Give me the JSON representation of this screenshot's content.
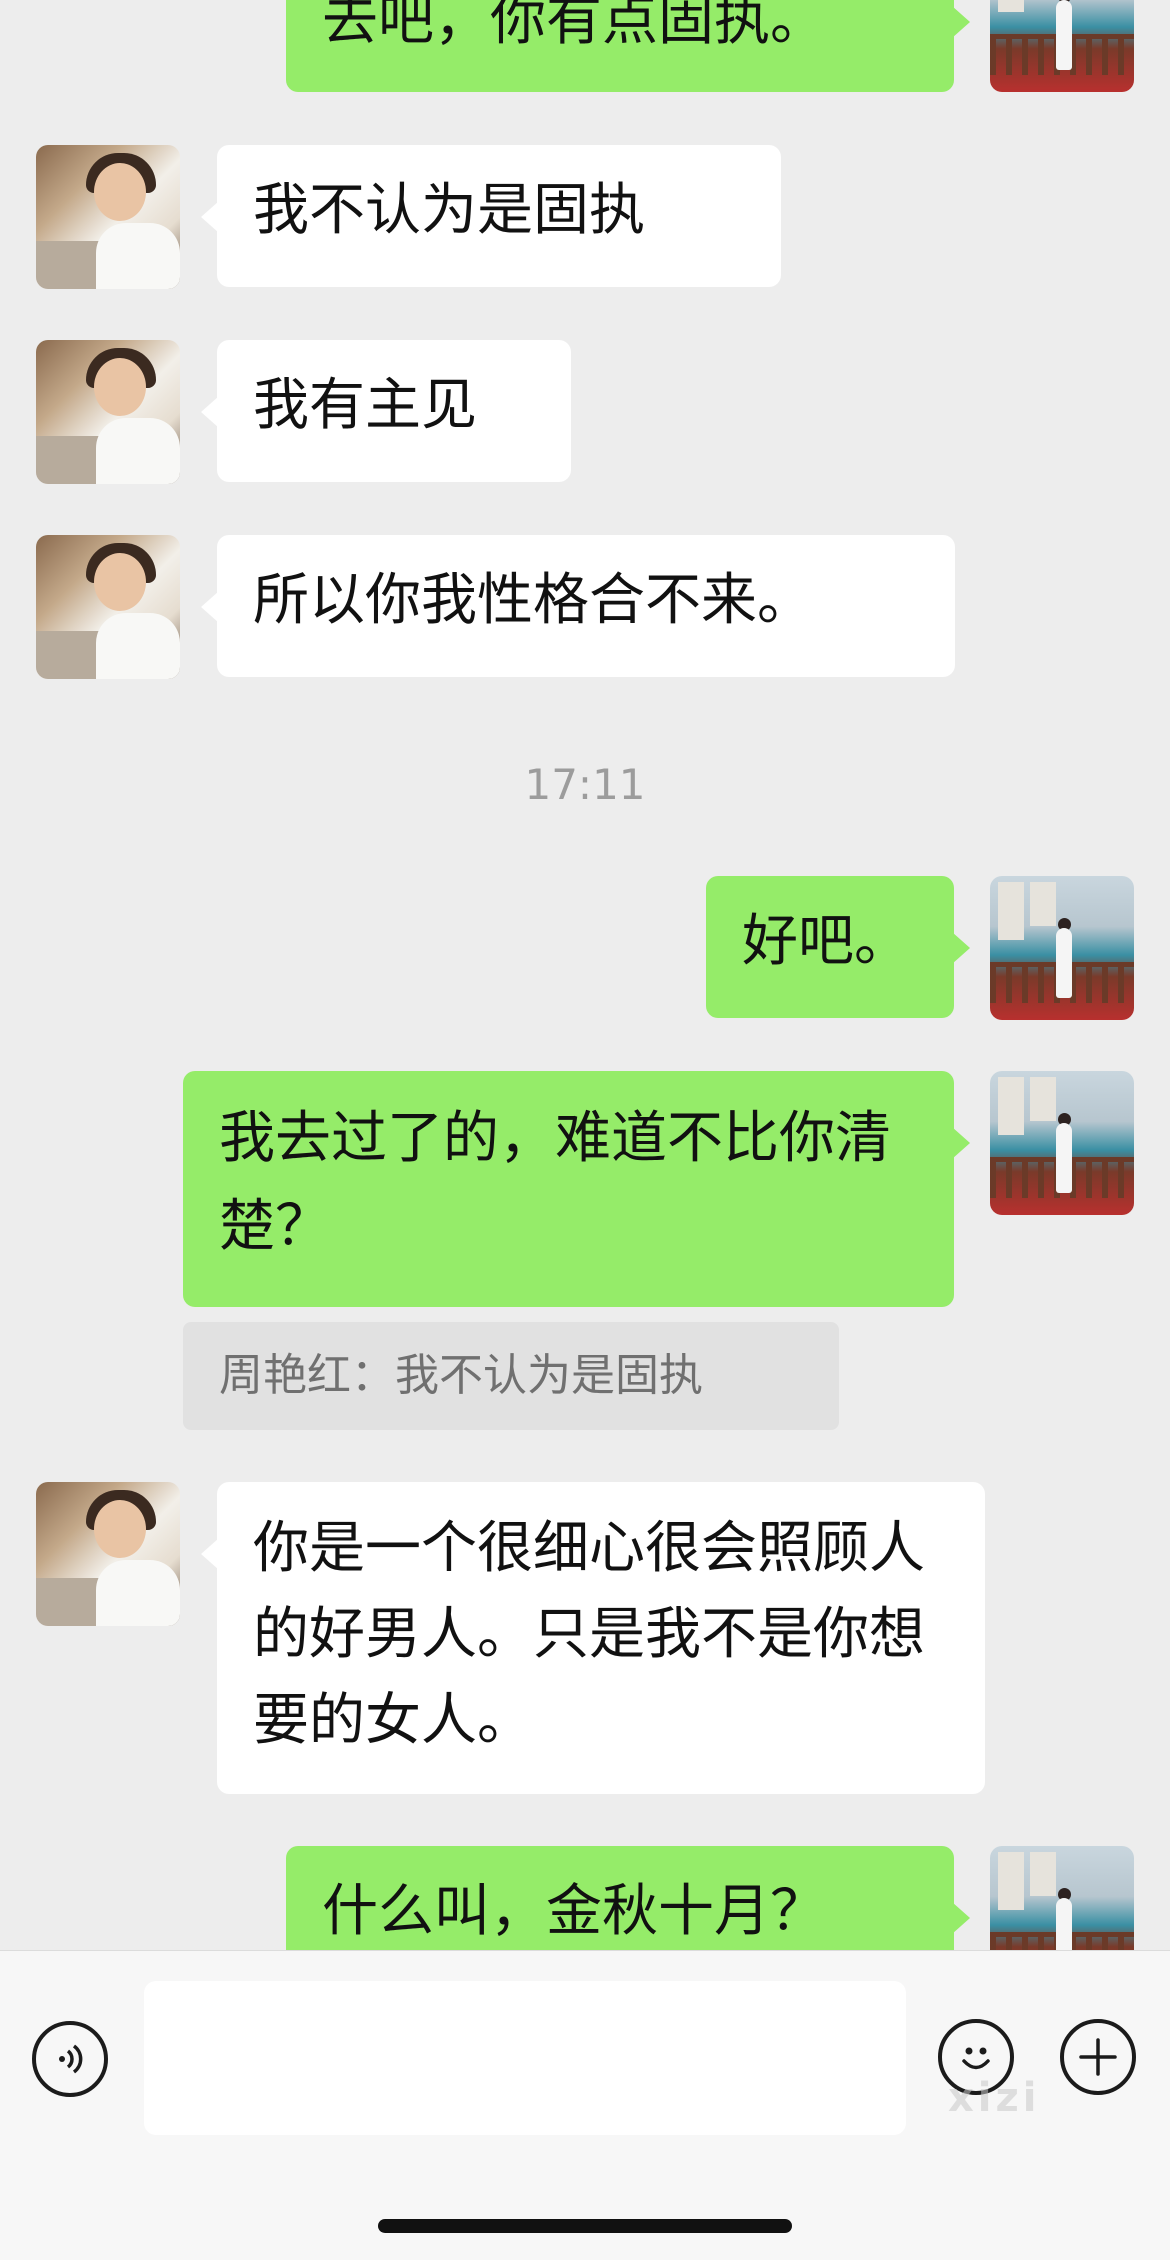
{
  "messages": {
    "m0": "去吧，你有点固执。",
    "m1": "我不认为是固执",
    "m2": "我有主见",
    "m3": "所以你我性格合不来。",
    "m4": "好吧。",
    "m5": "我去过了的，难道不比你清楚？",
    "m6": "你是一个很细心很会照顾人的好男人。只是我不是你想要的女人。",
    "m7": "什么叫，金秋十月？"
  },
  "timestamp": "17:11",
  "quote": {
    "text": "周艳红：我不认为是固执"
  },
  "input_bar": {
    "value": "",
    "voice_icon": "voice-icon",
    "emoji_icon": "emoji-icon",
    "plus_icon": "plus-icon"
  },
  "watermark": "xizi",
  "colors": {
    "background": "#ededed",
    "outgoing_bubble": "#95ec69",
    "incoming_bubble": "#ffffff",
    "quote_bg": "#e1e1e1"
  }
}
